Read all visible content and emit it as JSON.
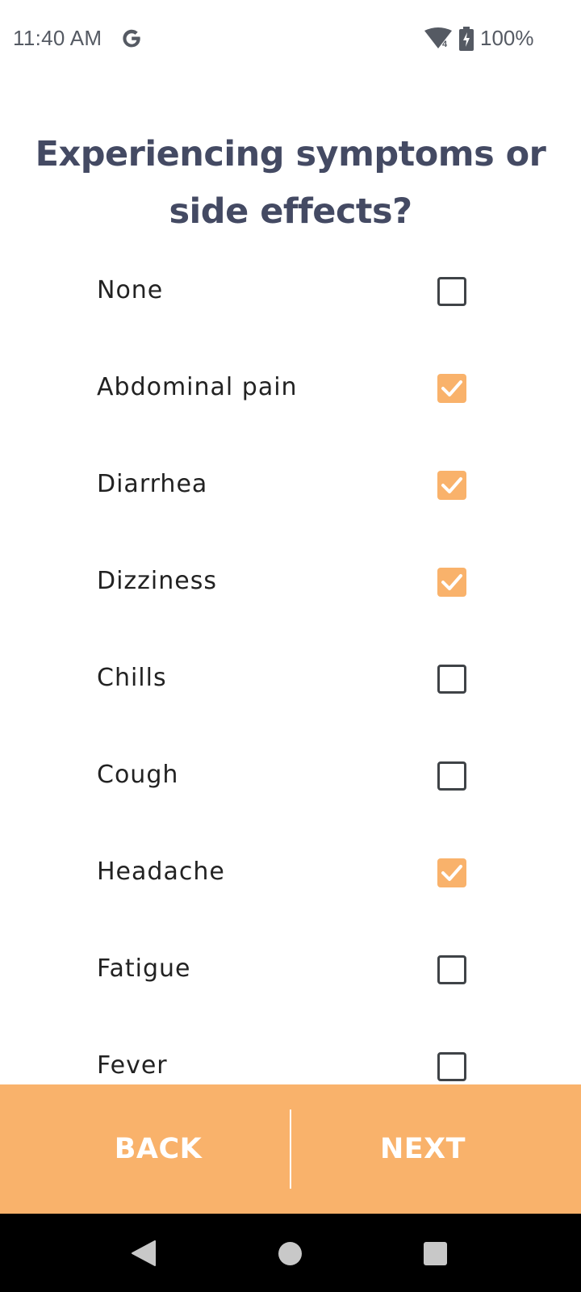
{
  "status_bar": {
    "time": "11:40 AM",
    "battery": "100%",
    "wifi_badge": "4",
    "icons": [
      "google-g-icon",
      "wifi-icon",
      "battery-charging-icon"
    ]
  },
  "title": "Experiencing symptoms or side effects?",
  "symptoms": [
    {
      "label": "None",
      "checked": false
    },
    {
      "label": "Abdominal pain",
      "checked": true
    },
    {
      "label": "Diarrhea",
      "checked": true
    },
    {
      "label": "Dizziness",
      "checked": true
    },
    {
      "label": "Chills",
      "checked": false
    },
    {
      "label": "Cough",
      "checked": false
    },
    {
      "label": "Headache",
      "checked": true
    },
    {
      "label": "Fatigue",
      "checked": false
    },
    {
      "label": "Fever",
      "checked": false
    }
  ],
  "actions": {
    "back_label": "BACK",
    "next_label": "NEXT"
  },
  "colors": {
    "accent": "#f9b26b",
    "title": "#444a63",
    "text": "#222222",
    "checkbox_border": "#3f4347"
  },
  "nav_bar": {
    "icons": [
      "nav-back-icon",
      "nav-home-icon",
      "nav-recents-icon"
    ]
  }
}
